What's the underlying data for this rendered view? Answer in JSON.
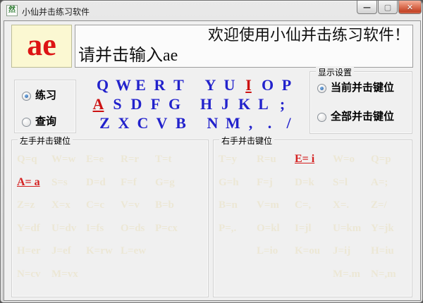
{
  "window": {
    "title": "小仙并击练习软件"
  },
  "icons": {
    "app_glyph": "然",
    "minimize": "—",
    "maximize": "▢",
    "close": "✕"
  },
  "colors": {
    "key_blue": "#2222cc",
    "active_red": "#cc1111",
    "faint_mapping": "#ece7d5",
    "syllable_bg": "#fbf8d2"
  },
  "practice": {
    "current_syllable": "ae",
    "welcome_text": "欢迎使用小仙并击练习软件！",
    "prompt_text": "请并击输入ae"
  },
  "mode_group": {
    "options": [
      {
        "label": "练习",
        "selected": true
      },
      {
        "label": "查询",
        "selected": false
      }
    ]
  },
  "display_group": {
    "title": "显示设置",
    "options": [
      {
        "label": "当前并击键位",
        "selected": true
      },
      {
        "label": "全部并击键位",
        "selected": false
      }
    ]
  },
  "keyboard": {
    "rows": [
      [
        {
          "c": "Q"
        },
        {
          "c": "W"
        },
        {
          "c": "E"
        },
        {
          "c": "R"
        },
        {
          "c": "T"
        },
        {
          "c": "Y",
          "gap": true
        },
        {
          "c": "U"
        },
        {
          "c": "I",
          "active": true
        },
        {
          "c": "O"
        },
        {
          "c": "P"
        }
      ],
      [
        {
          "c": "A",
          "active": true
        },
        {
          "c": "S"
        },
        {
          "c": "D"
        },
        {
          "c": "F"
        },
        {
          "c": "G"
        },
        {
          "c": "H",
          "gap": true
        },
        {
          "c": "J"
        },
        {
          "c": "K"
        },
        {
          "c": "L"
        },
        {
          "c": ";"
        }
      ],
      [
        {
          "c": "Z"
        },
        {
          "c": "X"
        },
        {
          "c": "C"
        },
        {
          "c": "V"
        },
        {
          "c": "B"
        },
        {
          "c": "N",
          "gap": true
        },
        {
          "c": "M"
        },
        {
          "c": ","
        },
        {
          "c": "."
        },
        {
          "c": "/"
        }
      ]
    ]
  },
  "left_hand": {
    "title": "左手并击键位",
    "rows": [
      [
        {
          "t": "Q=q"
        },
        {
          "t": "W=w"
        },
        {
          "t": "E=e"
        },
        {
          "t": "R=r"
        },
        {
          "t": "T=t"
        }
      ],
      [
        {
          "t": "A= a",
          "active": true
        },
        {
          "t": "S=s"
        },
        {
          "t": "D=d"
        },
        {
          "t": "F=f"
        },
        {
          "t": "G=g"
        }
      ],
      [
        {
          "t": "Z=z"
        },
        {
          "t": "X=x"
        },
        {
          "t": "C=c"
        },
        {
          "t": "V=v"
        },
        {
          "t": "B=b"
        }
      ],
      [
        {
          "t": "Y=df"
        },
        {
          "t": "U=dv"
        },
        {
          "t": "I=fs"
        },
        {
          "t": "O=ds"
        },
        {
          "t": "P=cx"
        }
      ],
      [
        {
          "t": "H=er"
        },
        {
          "t": "J=ef"
        },
        {
          "t": "K=rw"
        },
        {
          "t": "L=ew"
        },
        null
      ],
      [
        {
          "t": "N=cv"
        },
        {
          "t": "M=vx"
        },
        null,
        null,
        null
      ]
    ]
  },
  "right_hand": {
    "title": "右手并击键位",
    "rows": [
      [
        {
          "t": "T=y"
        },
        {
          "t": "R=u"
        },
        {
          "t": "E= i",
          "active": true
        },
        {
          "t": "W=o"
        },
        {
          "t": "Q=p"
        }
      ],
      [
        {
          "t": "G=h"
        },
        {
          "t": "F=j"
        },
        {
          "t": "D=k"
        },
        {
          "t": "S=l"
        },
        {
          "t": "A=;"
        }
      ],
      [
        {
          "t": "B=n"
        },
        {
          "t": "V=m"
        },
        {
          "t": "C=,"
        },
        {
          "t": "X=."
        },
        {
          "t": "Z=/"
        }
      ],
      [
        {
          "t": "P=,."
        },
        {
          "t": "O=kl"
        },
        {
          "t": "I=jl"
        },
        {
          "t": "U=km"
        },
        {
          "t": "Y=jk"
        }
      ],
      [
        null,
        {
          "t": "L=io"
        },
        {
          "t": "K=ou"
        },
        {
          "t": "J=ij"
        },
        {
          "t": "H=iu"
        }
      ],
      [
        null,
        null,
        null,
        {
          "t": "M=.m"
        },
        {
          "t": "N=,m"
        }
      ]
    ]
  }
}
